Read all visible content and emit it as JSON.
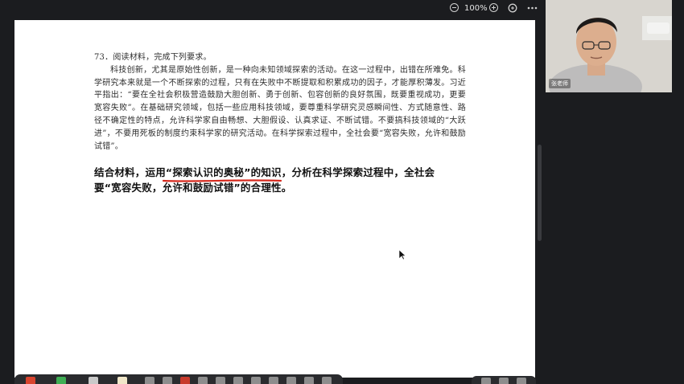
{
  "viewer": {
    "zoom_label": "100%"
  },
  "question": {
    "heading": "73．阅读材料，完成下列要求。",
    "body": "科技创新，尤其是原始性创新，是一种向未知领域探索的活动。在这一过程中，出错在所难免。科学研究本来就是一个不断探索的过程，只有在失败中不断提取和积累成功的因子，才能厚积薄发。习近平指出：“要在全社会积极营造鼓励大胆创新、勇于创新、包容创新的良好氛围，既要重视成功，更要宽容失败”。在基础研究领域，包括一些应用科技领域，要尊重科学研究灵感瞬间性、方式随意性、路径不确定性的特点，允许科学家自由畅想、大胆假设、认真求证、不断试错。不要搞科技领域的“大跃进”，不要用死板的制度约束科学家的研究活动。在科学探索过程中，全社会要“宽容失败，允许和鼓励试错”。",
    "task_prefix": "结合材料，运用",
    "task_highlight": "“探索认识的奥秘”",
    "task_suffix": "的知识，分析在科学探索过程中，全社会要“宽容失败，允许和鼓励试错”的合理性。"
  },
  "webcam": {
    "name_label": "张老师"
  },
  "colors": {
    "underline": "#d62a1e",
    "background": "#1b1c1f"
  },
  "icons": [
    "zoom-out-icon",
    "zoom-in-icon",
    "fullscreen-icon",
    "more-icon",
    "mouse-cursor-icon"
  ]
}
